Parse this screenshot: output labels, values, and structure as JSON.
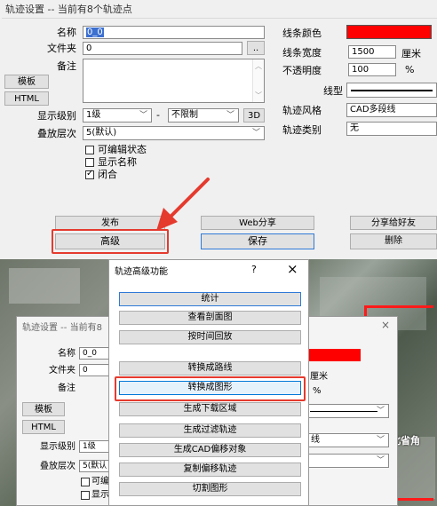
{
  "top": {
    "title": "轨迹设置 -- 当前有8个轨迹点",
    "labels": {
      "name": "名称",
      "folder": "文件夹",
      "note": "备注",
      "level": "显示级别",
      "layer": "叠放层次",
      "line_color": "线条颜色",
      "line_width": "线条宽度",
      "opacity": "不透明度",
      "line_type": "线型",
      "style": "轨迹风格",
      "category": "轨迹类别"
    },
    "values": {
      "name": "0_0",
      "folder": "0",
      "line_width": "1500",
      "line_width_unit": "厘米",
      "opacity": "100",
      "opacity_unit": "%",
      "style": "CAD多段线",
      "category": "无",
      "level_from": "1级",
      "level_sep": "-",
      "level_to": "不限制",
      "layer": "5(默认)"
    },
    "buttons": {
      "browse": "..",
      "template": "模板",
      "html": "HTML",
      "three_d": "3D",
      "publish": "发布",
      "advanced": "高级",
      "web_share": "Web分享",
      "save": "保存",
      "share_friend": "分享给好友",
      "delete": "删除"
    },
    "checkboxes": [
      {
        "label": "可编辑状态",
        "checked": false
      },
      {
        "label": "显示名称",
        "checked": false
      },
      {
        "label": "闭合",
        "checked": true
      }
    ],
    "colors": {
      "line_color": "#ff0000",
      "highlight": "#e53a2e",
      "arrow": "#e53a2e"
    }
  },
  "bottom": {
    "back_title": "轨迹设置 -- 当前有8",
    "back_labels": {
      "name": "名称",
      "folder": "文件夹",
      "note": "备注",
      "level": "显示级别",
      "layer": "叠放层次"
    },
    "back_values": {
      "name": "0_0",
      "folder": "0",
      "level": "1级",
      "layer": "5(默认",
      "style_tail": "线",
      "unit": "厘米",
      "pct": "%"
    },
    "back_buttons": {
      "template": "模板",
      "html": "HTML",
      "close": "×"
    },
    "back_checks": [
      "可编",
      "显示"
    ],
    "map_text": "北省角",
    "dialog": {
      "title": "轨迹高级功能",
      "help": "?",
      "close": "×",
      "functions": [
        "统计",
        "查看剖面图",
        "按时间回放",
        "转换成路线",
        "转换成图形",
        "生成下载区域",
        "生成过滤轨迹",
        "生成CAD偏移对象",
        "复制偏移轨迹",
        "切割图形"
      ]
    }
  }
}
